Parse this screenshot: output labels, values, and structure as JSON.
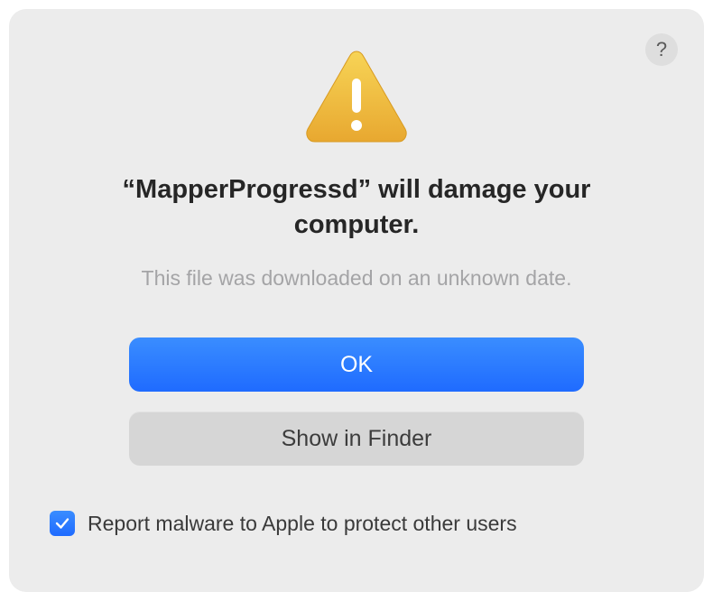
{
  "help": {
    "label": "?"
  },
  "headline": "“MapperProgressd” will damage your computer.",
  "subtext": "This file was downloaded on an unknown date.",
  "buttons": {
    "primary": "OK",
    "secondary": "Show in Finder"
  },
  "checkbox": {
    "checked": true,
    "label": "Report malware to Apple to protect other users"
  }
}
